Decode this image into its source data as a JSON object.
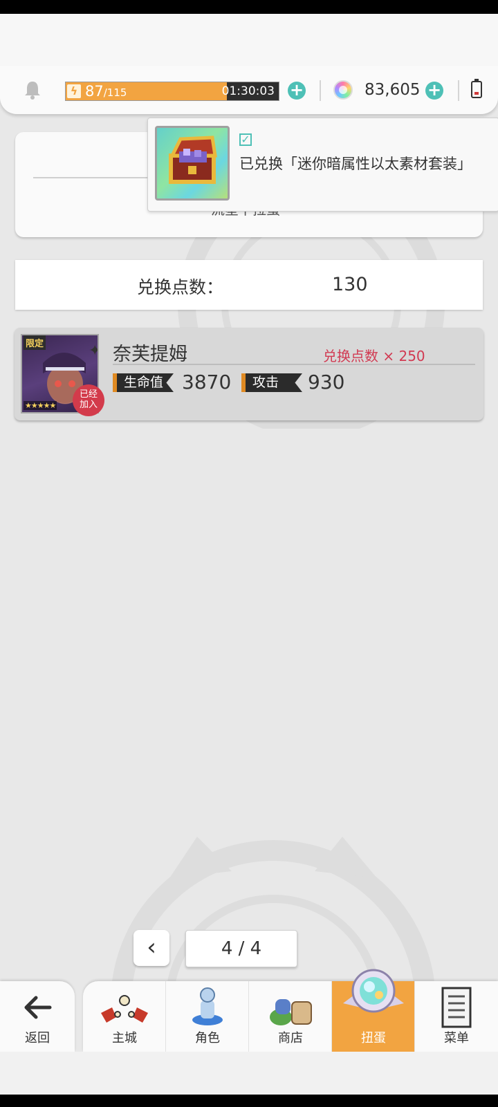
{
  "hud": {
    "stamina_current": "87",
    "stamina_max": "/115",
    "stamina_fraction": 0.757,
    "stamina_timer": "01:30:03",
    "gem_count": "83,605",
    "icons": [
      "bell-icon",
      "lightning-icon",
      "plus-icon",
      "rainbow-orb-icon",
      "battery-icon"
    ]
  },
  "partial_card": {
    "text": "流星下拉蛋"
  },
  "toast": {
    "message": "已兑换「迷你暗属性以太素材套装」",
    "icon": "treasure-chest-icon"
  },
  "exchange_points": {
    "label": "兑换点数：",
    "value": "130"
  },
  "character": {
    "name": "奈芙提姆",
    "limited_badge": "限定",
    "stars": "★★★★★",
    "joined_badge_line1": "已经",
    "joined_badge_line2": "加入",
    "cost": "兑换点数 × 250",
    "hp_label": "生命值",
    "hp_value": "3870",
    "atk_label": "攻击",
    "atk_value": "930"
  },
  "pager": {
    "prev": "‹",
    "page": "4 / 4"
  },
  "nav": {
    "back": "返回",
    "items": [
      {
        "label": "主城",
        "icon": "town-icon"
      },
      {
        "label": "角色",
        "icon": "character-icon"
      },
      {
        "label": "商店",
        "icon": "shop-icon"
      },
      {
        "label": "扭蛋",
        "icon": "gacha-icon",
        "active": true
      },
      {
        "label": "菜单",
        "icon": "menu-icon"
      }
    ]
  },
  "colors": {
    "accent": "#f2a441",
    "teal": "#4ec0b6",
    "red": "#d13a52"
  }
}
